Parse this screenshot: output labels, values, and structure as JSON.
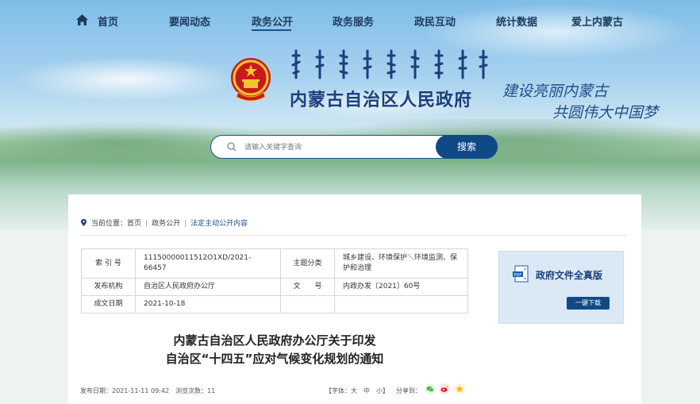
{
  "nav": {
    "items": [
      {
        "label": "首页"
      },
      {
        "label": "要闻动态"
      },
      {
        "label": "政务公开"
      },
      {
        "label": "政务服务"
      },
      {
        "label": "政民互动"
      },
      {
        "label": "统计数据"
      },
      {
        "label": "爱上内蒙古"
      }
    ],
    "active": "政务公开"
  },
  "header": {
    "title": "内蒙古自治区人民政府",
    "slogan_line1": "建设亮丽内蒙古",
    "slogan_line2": "共圆伟大中国梦"
  },
  "search": {
    "placeholder": "请输入关键字查询",
    "button_label": "搜索"
  },
  "breadcrumb": {
    "prefix": "当前位置：",
    "items": [
      "首页",
      "政务公开",
      "法定主动公开内容"
    ]
  },
  "meta_table": {
    "index_label": "索 引 号",
    "index_value": "11150000011512O1XD/2021-66457",
    "topic_label": "主题分类",
    "topic_value": "城乡建设、环境保护＼环境监测、保护和治理",
    "issuer_label": "发布机构",
    "issuer_value": "自治区人民政府办公厅",
    "docno_label": "文　　号",
    "docno_value": "内政办发〔2021〕60号",
    "date_label": "成文日期",
    "date_value": "2021-10-18"
  },
  "document": {
    "title_line1": "内蒙古自治区人民政府办公厅关于印发",
    "title_line2": "自治区“十四五”应对气候变化规划的通知",
    "publish_info": "发布日期：2021-11-11 09:42　浏览次数：11",
    "font_size_label": "【字体：大　中　小】",
    "share_label": "分享到："
  },
  "side_card": {
    "title": "政府文件全真版",
    "button_label": "一键下载"
  },
  "colors": {
    "primary": "#0f4a87",
    "title_blue": "#1c3f7a",
    "card_bg": "#dbe9f7"
  }
}
